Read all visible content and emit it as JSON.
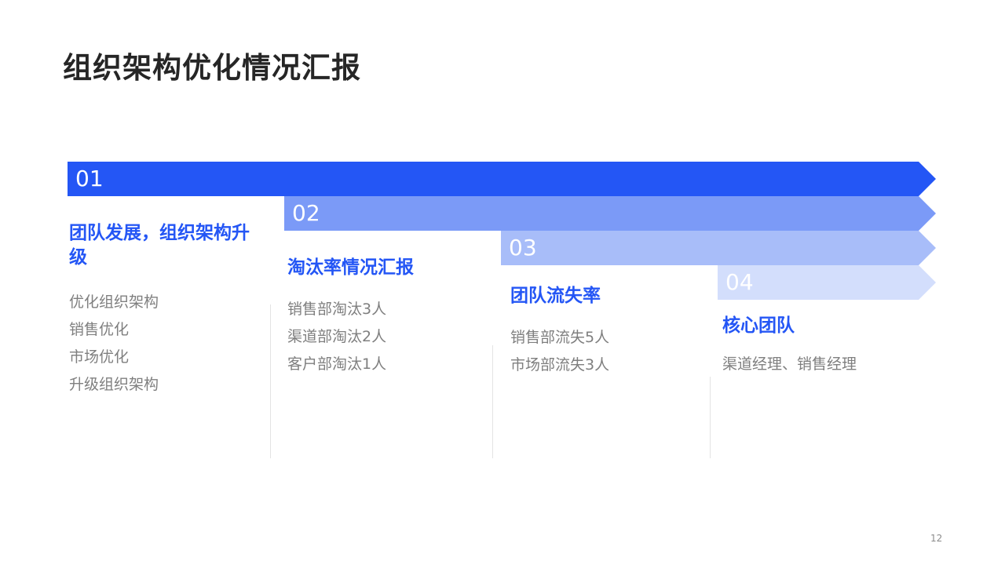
{
  "title": "组织架构优化情况汇报",
  "colors": {
    "band1": "#2456f5",
    "band2": "#7b9af7",
    "band3": "#a8bdf9",
    "band4": "#d3defc",
    "heading": "#2456f5",
    "item": "#7f7f7f"
  },
  "bands": [
    {
      "num": "01"
    },
    {
      "num": "02"
    },
    {
      "num": "03"
    },
    {
      "num": "04"
    }
  ],
  "columns": [
    {
      "heading": "团队发展，组织架构升级",
      "items": [
        "优化组织架构",
        "销售优化",
        "市场优化",
        "升级组织架构"
      ]
    },
    {
      "heading": "淘汰率情况汇报",
      "items": [
        "销售部淘汰3人",
        "渠道部淘汰2人",
        "客户部淘汰1人"
      ]
    },
    {
      "heading": "团队流失率",
      "items": [
        "销售部流失5人",
        "市场部流失3人"
      ]
    },
    {
      "heading": "核心团队",
      "items": [
        "渠道经理、销售经理"
      ]
    }
  ],
  "page_number": "12"
}
